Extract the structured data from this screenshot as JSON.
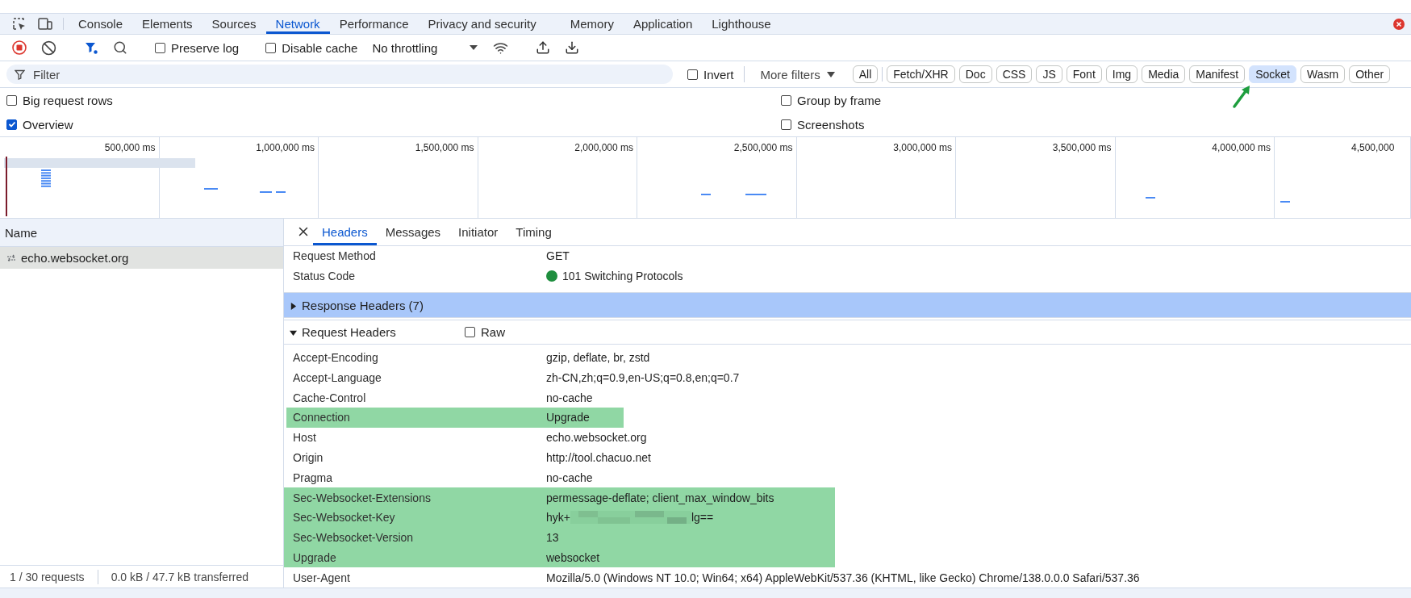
{
  "tabs": [
    {
      "label": "Console",
      "selected": false
    },
    {
      "label": "Elements",
      "selected": false
    },
    {
      "label": "Sources",
      "selected": false
    },
    {
      "label": "Network",
      "selected": true
    },
    {
      "label": "Performance",
      "selected": false
    },
    {
      "label": "Privacy and security",
      "selected": false
    },
    {
      "label": "Memory",
      "selected": false
    },
    {
      "label": "Application",
      "selected": false
    },
    {
      "label": "Lighthouse",
      "selected": false
    }
  ],
  "toolbar": {
    "checkboxes": [
      {
        "label": "Preserve log",
        "checked": false
      },
      {
        "label": "Disable cache",
        "checked": false
      }
    ],
    "throttling": "No throttling"
  },
  "filter": {
    "placeholder": "Filter",
    "invert": {
      "label": "Invert",
      "checked": false
    },
    "more_filters": "More filters",
    "types": [
      {
        "label": "All",
        "selected": false
      },
      {
        "label": "Fetch/XHR",
        "selected": false
      },
      {
        "label": "Doc",
        "selected": false
      },
      {
        "label": "CSS",
        "selected": false
      },
      {
        "label": "JS",
        "selected": false
      },
      {
        "label": "Font",
        "selected": false
      },
      {
        "label": "Img",
        "selected": false
      },
      {
        "label": "Media",
        "selected": false
      },
      {
        "label": "Manifest",
        "selected": false
      },
      {
        "label": "Socket",
        "selected": true
      },
      {
        "label": "Wasm",
        "selected": false
      },
      {
        "label": "Other",
        "selected": false
      }
    ]
  },
  "options": [
    {
      "label": "Big request rows",
      "checked": false
    },
    {
      "label": "Group by frame",
      "checked": false
    },
    {
      "label": "Overview",
      "checked": true
    },
    {
      "label": "Screenshots",
      "checked": false
    }
  ],
  "timeline": {
    "ticks": [
      "500,000 ms",
      "1,000,000 ms",
      "1,500,000 ms",
      "2,000,000 ms",
      "2,500,000 ms",
      "3,000,000 ms",
      "3,500,000 ms",
      "4,000,000 ms",
      "4,500,000"
    ]
  },
  "requests": {
    "column": "Name",
    "rows": [
      {
        "name": "echo.websocket.org",
        "selected": true
      }
    ]
  },
  "details": {
    "tabs": [
      {
        "label": "Headers",
        "selected": true
      },
      {
        "label": "Messages",
        "selected": false
      },
      {
        "label": "Initiator",
        "selected": false
      },
      {
        "label": "Timing",
        "selected": false
      }
    ],
    "general": [
      {
        "key": "Request Method",
        "value": "GET"
      },
      {
        "key": "Status Code",
        "value": "101 Switching Protocols",
        "color": "#1e8e3e"
      }
    ],
    "response_headers": {
      "title": "Response Headers (7)",
      "expanded": false,
      "selected": true
    },
    "request_headers": {
      "title": "Request Headers",
      "expanded": true,
      "raw": {
        "label": "Raw",
        "checked": false
      },
      "rows": [
        {
          "key": "Accept-Encoding",
          "value": "gzip, deflate, br, zstd",
          "highlighted": false
        },
        {
          "key": "Accept-Language",
          "value": "zh-CN,zh;q=0.9,en-US;q=0.8,en;q=0.7",
          "highlighted": false
        },
        {
          "key": "Cache-Control",
          "value": "no-cache",
          "highlighted": false
        },
        {
          "key": "Connection",
          "value": "Upgrade",
          "highlighted": true
        },
        {
          "key": "Host",
          "value": "echo.websocket.org",
          "highlighted": false
        },
        {
          "key": "Origin",
          "value": "http://tool.chacuo.net",
          "highlighted": false
        },
        {
          "key": "Pragma",
          "value": "no-cache",
          "highlighted": false
        },
        {
          "key": "Sec-Websocket-Extensions",
          "value": "permessage-deflate; client_max_window_bits",
          "highlighted": true
        },
        {
          "key": "Sec-Websocket-Key",
          "value": "hyk+",
          "value_end": "lg==",
          "redacted": true,
          "highlighted": true
        },
        {
          "key": "Sec-Websocket-Version",
          "value": "13",
          "highlighted": true
        },
        {
          "key": "Upgrade",
          "value": "websocket",
          "highlighted": true
        },
        {
          "key": "User-Agent",
          "value": "Mozilla/5.0 (Windows NT 10.0; Win64; x64) AppleWebKit/537.36 (KHTML, like Gecko) Chrome/138.0.0.0 Safari/537.36",
          "highlighted": false
        }
      ]
    }
  },
  "status_bar": {
    "requests": "1 / 30 requests",
    "transferred": "0.0 kB / 47.7 kB transferred"
  }
}
